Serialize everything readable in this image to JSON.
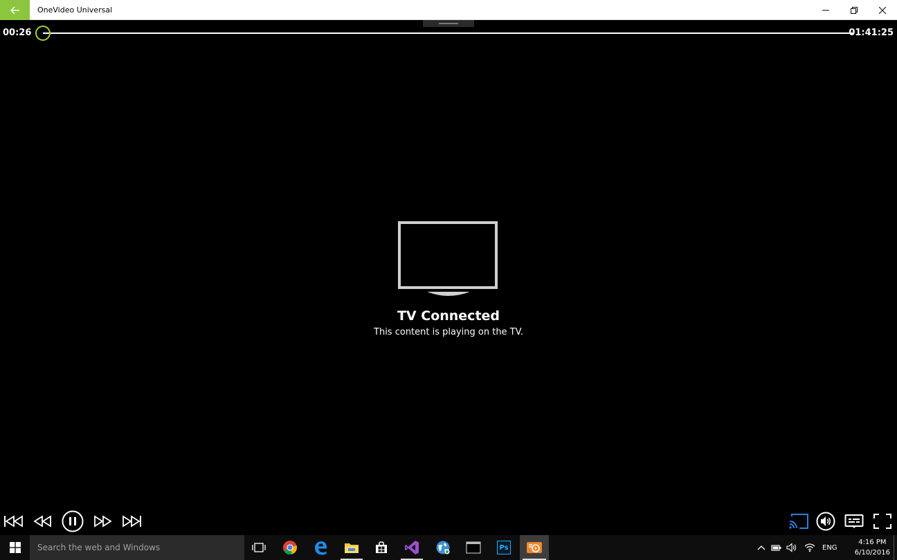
{
  "window": {
    "title": "OneVideo Universal"
  },
  "player": {
    "current_time": "00:26",
    "total_time": "01:41:25",
    "progress": 0.004,
    "status_title": "TV Connected",
    "status_subtitle": "This content is playing on the TV.",
    "accent_color": "#a6d12f",
    "cast_color": "#2d7fe0"
  },
  "controls": {
    "left": [
      "skip-previous-icon",
      "rewind-icon",
      "pause-icon",
      "fast-forward-icon",
      "skip-next-icon"
    ],
    "right": [
      "cast-icon",
      "volume-icon",
      "subtitles-icon",
      "fullscreen-icon"
    ]
  },
  "taskbar": {
    "search_placeholder": "Search the web and Windows",
    "apps": [
      "task-view-icon",
      "chrome-icon",
      "edge-icon",
      "file-explorer-icon",
      "store-icon",
      "visual-studio-icon",
      "web-globe-icon",
      "console-icon",
      "photoshop-icon",
      "onevideo-icon"
    ],
    "photoshop_label": "Ps",
    "tray_language": "ENG",
    "time": "4:16 PM",
    "date": "6/10/2016"
  }
}
